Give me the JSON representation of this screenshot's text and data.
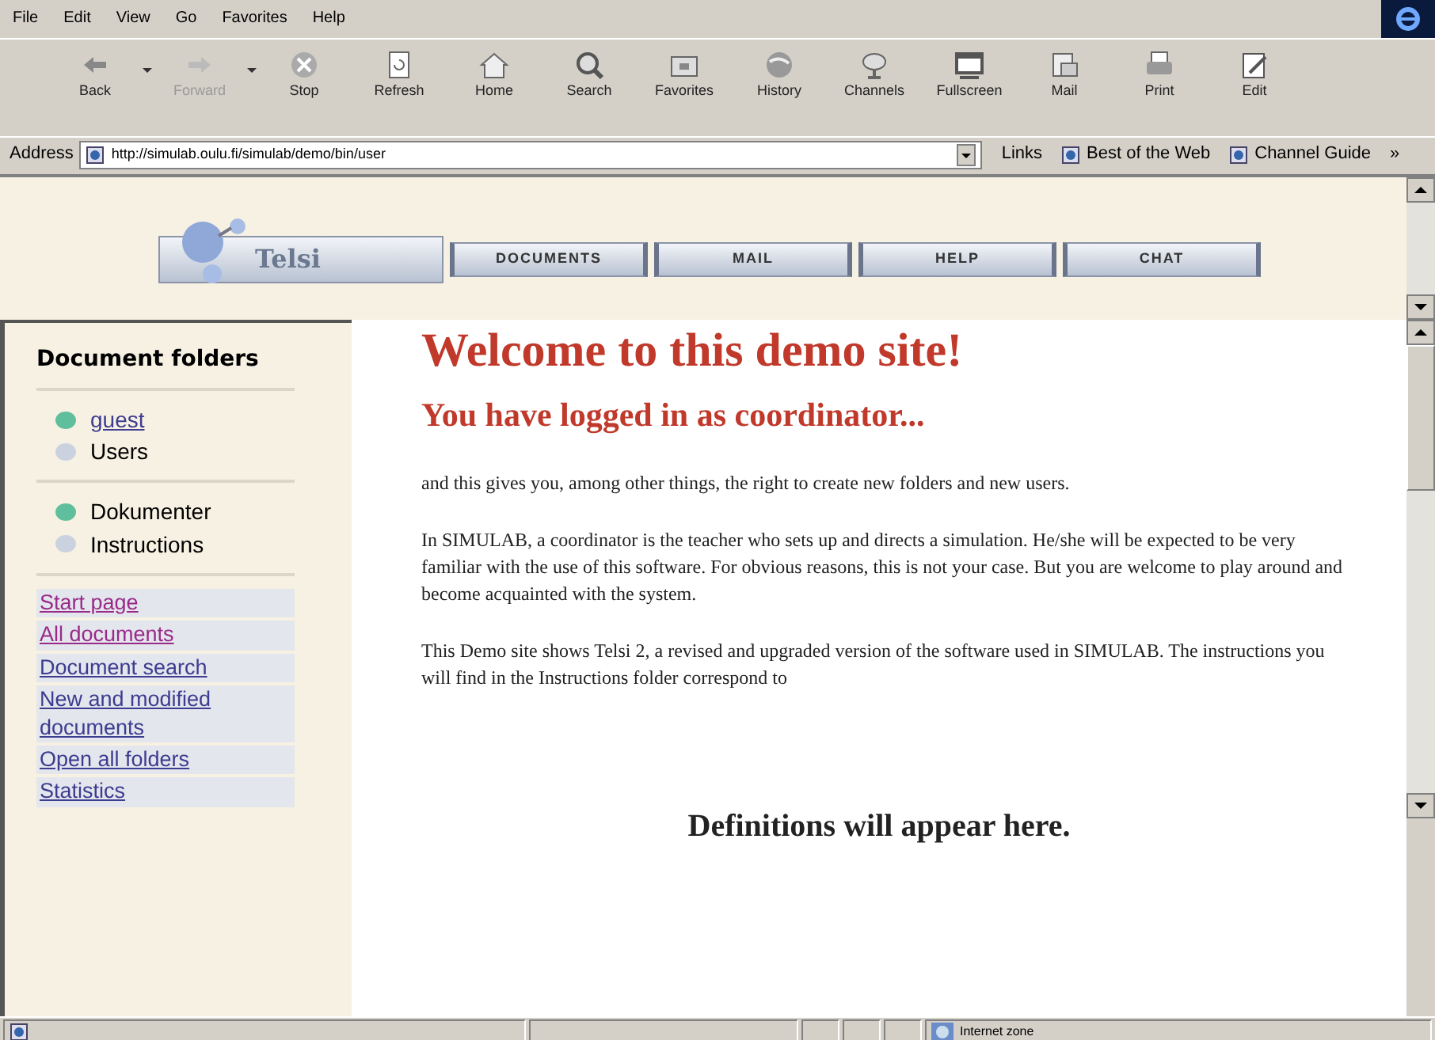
{
  "menu": [
    "File",
    "Edit",
    "View",
    "Go",
    "Favorites",
    "Help"
  ],
  "toolbar": [
    {
      "label": "Back",
      "disabled": false,
      "dropdown": true
    },
    {
      "label": "Forward",
      "disabled": true,
      "dropdown": true
    },
    {
      "label": "Stop",
      "disabled": false,
      "dropdown": false
    },
    {
      "label": "Refresh",
      "disabled": false,
      "dropdown": false
    },
    {
      "label": "Home",
      "disabled": false,
      "dropdown": false
    },
    {
      "label": "Search",
      "disabled": false,
      "dropdown": false
    },
    {
      "label": "Favorites",
      "disabled": false,
      "dropdown": false
    },
    {
      "label": "History",
      "disabled": false,
      "dropdown": false
    },
    {
      "label": "Channels",
      "disabled": false,
      "dropdown": false
    },
    {
      "label": "Fullscreen",
      "disabled": false,
      "dropdown": false
    },
    {
      "label": "Mail",
      "disabled": false,
      "dropdown": false
    },
    {
      "label": "Print",
      "disabled": false,
      "dropdown": false
    },
    {
      "label": "Edit",
      "disabled": false,
      "dropdown": false
    }
  ],
  "address": {
    "label": "Address",
    "value": "http://simulab.oulu.fi/simulab/demo/bin/user"
  },
  "links": {
    "label": "Links",
    "items": [
      "Best of the Web",
      "Channel Guide"
    ],
    "more": "»"
  },
  "site_nav": {
    "logo": "Telsi",
    "buttons": [
      "DOCUMENTS",
      "MAIL",
      "HELP",
      "CHAT"
    ]
  },
  "sidebar": {
    "title": "Document folders",
    "folder_groups": [
      [
        {
          "label": "guest",
          "link": true,
          "color": "#5fbf9c"
        },
        {
          "label": "Users",
          "link": false,
          "color": "#c9d2de"
        }
      ],
      [
        {
          "label": "Dokumenter",
          "link": false,
          "color": "#5fbf9c"
        },
        {
          "label": "Instructions",
          "link": false,
          "color": "#c9d2de"
        }
      ]
    ],
    "links": [
      {
        "label": "Start page",
        "visited": true
      },
      {
        "label": "All documents",
        "visited": true
      },
      {
        "label": "Document search",
        "visited": false
      },
      {
        "label": "New and modified documents",
        "visited": false
      },
      {
        "label": "Open all folders",
        "visited": false
      },
      {
        "label": "Statistics",
        "visited": false
      }
    ]
  },
  "main": {
    "heading": "Welcome to this demo site!",
    "subheading": "You have logged in as coordinator...",
    "paragraphs": [
      "and this gives you, among other things, the right to create new folders and new users.",
      "In SIMULAB, a coordinator is the teacher who sets up and directs a simulation. He/she will be expected to be very familiar with the use of this software. For obvious reasons, this is not your case. But you are welcome to play around and become acquainted with the system.",
      "This Demo site shows Telsi 2, a revised and upgraded version of the software used in SIMULAB. The instructions you will find in the Instructions folder correspond to"
    ],
    "definitions": "Definitions will appear here."
  },
  "status_bar": {
    "zone": "Internet zone"
  }
}
